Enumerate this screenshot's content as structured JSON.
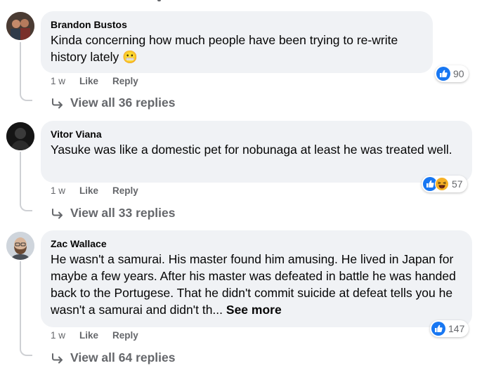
{
  "comments": [
    {
      "author": "Brandon Bustos",
      "text": "Kinda concerning how much people have been trying to re-write history lately",
      "emoji": "😬",
      "time": "1 w",
      "like_label": "Like",
      "reply_label": "Reply",
      "reaction_count": "90",
      "view_replies": "View all 36 replies"
    },
    {
      "author": "Vitor Viana",
      "text": "Yasuke was like a domestic pet for nobunaga at least he was treated well.",
      "time": "1 w",
      "like_label": "Like",
      "reply_label": "Reply",
      "reaction_count": "57",
      "view_replies": "View all 33 replies"
    },
    {
      "author": "Zac Wallace",
      "text": "He wasn't a samurai. His master found him amusing. He lived in Japan for maybe a few years. After his master was defeated in battle he was handed back to the Portugese. That he didn't commit suicide at defeat tells you he wasn't a samurai and didn't th...",
      "see_more": "See more",
      "time": "1 w",
      "like_label": "Like",
      "reply_label": "Reply",
      "reaction_count": "147",
      "view_replies": "View all 64 replies"
    }
  ],
  "colors": {
    "like_blue": "#1877f2",
    "bubble_bg": "#f0f2f5",
    "meta_gray": "#65676b",
    "haha_yellow": "#f7b125"
  }
}
